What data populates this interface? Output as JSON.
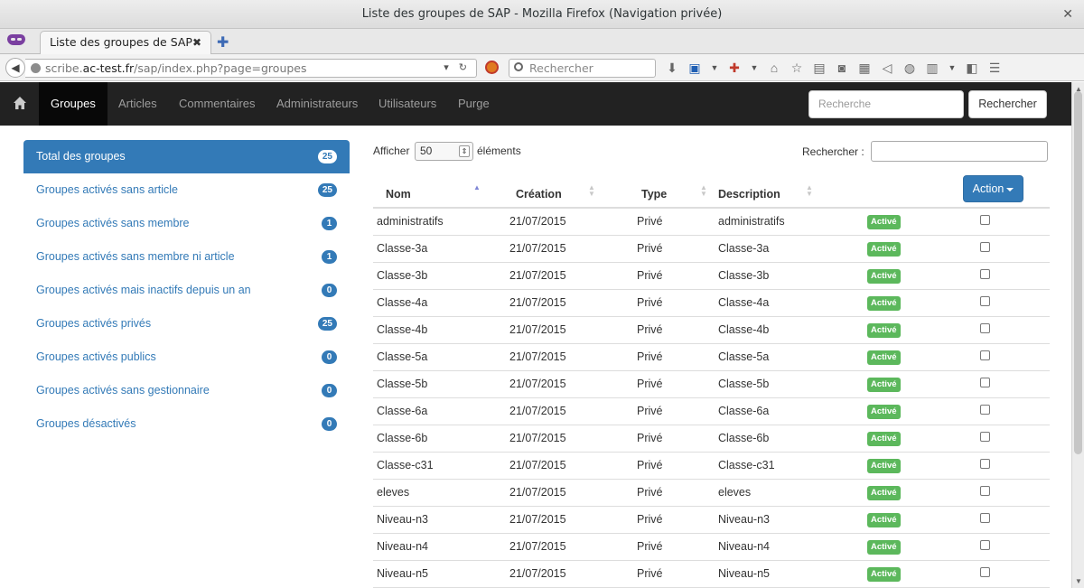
{
  "window": {
    "title": "Liste des groupes de SAP - Mozilla Firefox (Navigation privée)"
  },
  "browser": {
    "tab_title": "Liste des groupes de SAP",
    "url_prefix": "scribe.",
    "url_domain": "ac-test.fr",
    "url_path": "/sap/index.php?page=groupes",
    "search_placeholder": "Rechercher"
  },
  "nav": {
    "items": [
      {
        "label": "Groupes",
        "active": true
      },
      {
        "label": "Articles"
      },
      {
        "label": "Commentaires"
      },
      {
        "label": "Administrateurs"
      },
      {
        "label": "Utilisateurs"
      },
      {
        "label": "Purge"
      }
    ],
    "search_placeholder": "Recherche",
    "search_button": "Rechercher"
  },
  "sidebar": {
    "items": [
      {
        "label": "Total des groupes",
        "count": "25",
        "active": true
      },
      {
        "label": "Groupes activés sans article",
        "count": "25"
      },
      {
        "label": "Groupes activés sans membre",
        "count": "1"
      },
      {
        "label": "Groupes activés sans membre ni article",
        "count": "1"
      },
      {
        "label": "Groupes activés mais inactifs depuis un an",
        "count": "0"
      },
      {
        "label": "Groupes activés privés",
        "count": "25"
      },
      {
        "label": "Groupes activés publics",
        "count": "0"
      },
      {
        "label": "Groupes activés sans gestionnaire",
        "count": "0"
      },
      {
        "label": "Groupes désactivés",
        "count": "0"
      }
    ]
  },
  "table_controls": {
    "show_label": "Afficher",
    "page_size": "50",
    "elements_label": "éléments",
    "search_label": "Rechercher :",
    "action_label": "Action"
  },
  "table": {
    "headers": {
      "nom": "Nom",
      "creation": "Création",
      "type": "Type",
      "description": "Description"
    },
    "rows": [
      {
        "nom": "administratifs",
        "creation": "21/07/2015",
        "type": "Privé",
        "description": "administratifs",
        "statut": "Activé"
      },
      {
        "nom": "Classe-3a",
        "creation": "21/07/2015",
        "type": "Privé",
        "description": "Classe-3a",
        "statut": "Activé"
      },
      {
        "nom": "Classe-3b",
        "creation": "21/07/2015",
        "type": "Privé",
        "description": "Classe-3b",
        "statut": "Activé"
      },
      {
        "nom": "Classe-4a",
        "creation": "21/07/2015",
        "type": "Privé",
        "description": "Classe-4a",
        "statut": "Activé"
      },
      {
        "nom": "Classe-4b",
        "creation": "21/07/2015",
        "type": "Privé",
        "description": "Classe-4b",
        "statut": "Activé"
      },
      {
        "nom": "Classe-5a",
        "creation": "21/07/2015",
        "type": "Privé",
        "description": "Classe-5a",
        "statut": "Activé"
      },
      {
        "nom": "Classe-5b",
        "creation": "21/07/2015",
        "type": "Privé",
        "description": "Classe-5b",
        "statut": "Activé"
      },
      {
        "nom": "Classe-6a",
        "creation": "21/07/2015",
        "type": "Privé",
        "description": "Classe-6a",
        "statut": "Activé"
      },
      {
        "nom": "Classe-6b",
        "creation": "21/07/2015",
        "type": "Privé",
        "description": "Classe-6b",
        "statut": "Activé"
      },
      {
        "nom": "Classe-c31",
        "creation": "21/07/2015",
        "type": "Privé",
        "description": "Classe-c31",
        "statut": "Activé"
      },
      {
        "nom": "eleves",
        "creation": "21/07/2015",
        "type": "Privé",
        "description": "eleves",
        "statut": "Activé"
      },
      {
        "nom": "Niveau-n3",
        "creation": "21/07/2015",
        "type": "Privé",
        "description": "Niveau-n3",
        "statut": "Activé"
      },
      {
        "nom": "Niveau-n4",
        "creation": "21/07/2015",
        "type": "Privé",
        "description": "Niveau-n4",
        "statut": "Activé"
      },
      {
        "nom": "Niveau-n5",
        "creation": "21/07/2015",
        "type": "Privé",
        "description": "Niveau-n5",
        "statut": "Activé"
      }
    ]
  },
  "colors": {
    "brand": "#337ab7",
    "navbar": "#222222",
    "status_active": "#5cb85c"
  }
}
